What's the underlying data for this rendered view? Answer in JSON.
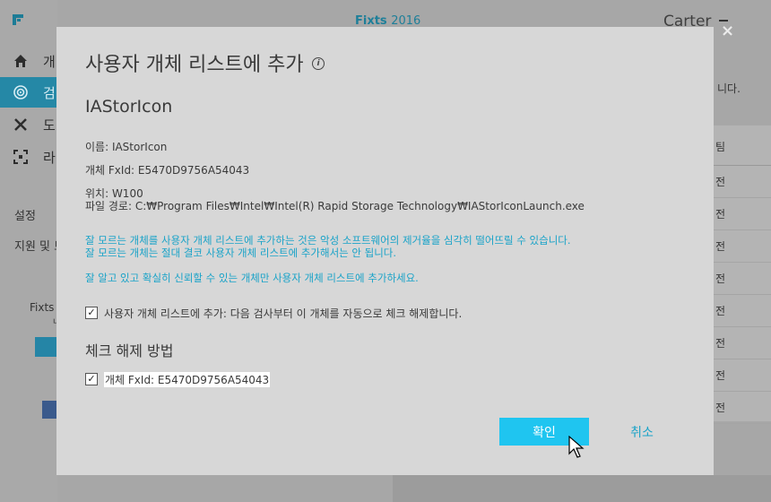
{
  "app": {
    "title": "Fixts",
    "year": "2016",
    "user": "Carter"
  },
  "sidebar": {
    "items": [
      {
        "label": "개"
      },
      {
        "label": "검"
      },
      {
        "label": "도"
      },
      {
        "label": "라"
      }
    ],
    "settings": "설정",
    "support": "지원 및 브",
    "promo_line1": "Fixts",
    "promo_line2": "ㄴ"
  },
  "right_panel": {
    "text": "니다.",
    "header": "팀",
    "rows": [
      "전",
      "전",
      "전",
      "전",
      "전",
      "전",
      "전",
      "전"
    ]
  },
  "dialog": {
    "title": "사용자 개체 리스트에 추가",
    "info_icon": "i",
    "object_name": "IAStorIcon",
    "name_field": "이름: IAStorIcon",
    "fxid_field": "개체 FxId: E5470D9756A54043",
    "location_field": "위치: W100",
    "path_field": "파일 경로: C:₩Program Files₩Intel₩Intel(R) Rapid Storage Technology₩IAStorIconLaunch.exe",
    "warning_line1": "잘 모르는 개체를 사용자 개체 리스트에 추가하는 것은 악성 소프트웨어의 제거율을 심각히 떨어뜨릴 수 있습니다.",
    "warning_line2": "잘 모르는 개체는 절대 결코 사용자 개체 리스트에 추가해서는 안 됩니다.",
    "warning_line3": "잘 알고 있고 확실히 신뢰할 수 있는 개체만 사용자 개체 리스트에 추가하세요.",
    "add_checkbox_label": "사용자 개체 리스트에 추가: 다음 검사부터 이 개체를 자동으로 체크 해제합니다.",
    "uncheck_section": "체크 해제 방법",
    "fxid_checkbox_label": "개체 FxId: E5470D9756A54043",
    "ok_label": "확인",
    "cancel_label": "취소",
    "close_label": "×",
    "check_mark": "✓"
  },
  "colors": {
    "accent": "#1fc5f0",
    "link": "#1aa3c8",
    "dialog_bg": "#d7d7d7"
  }
}
